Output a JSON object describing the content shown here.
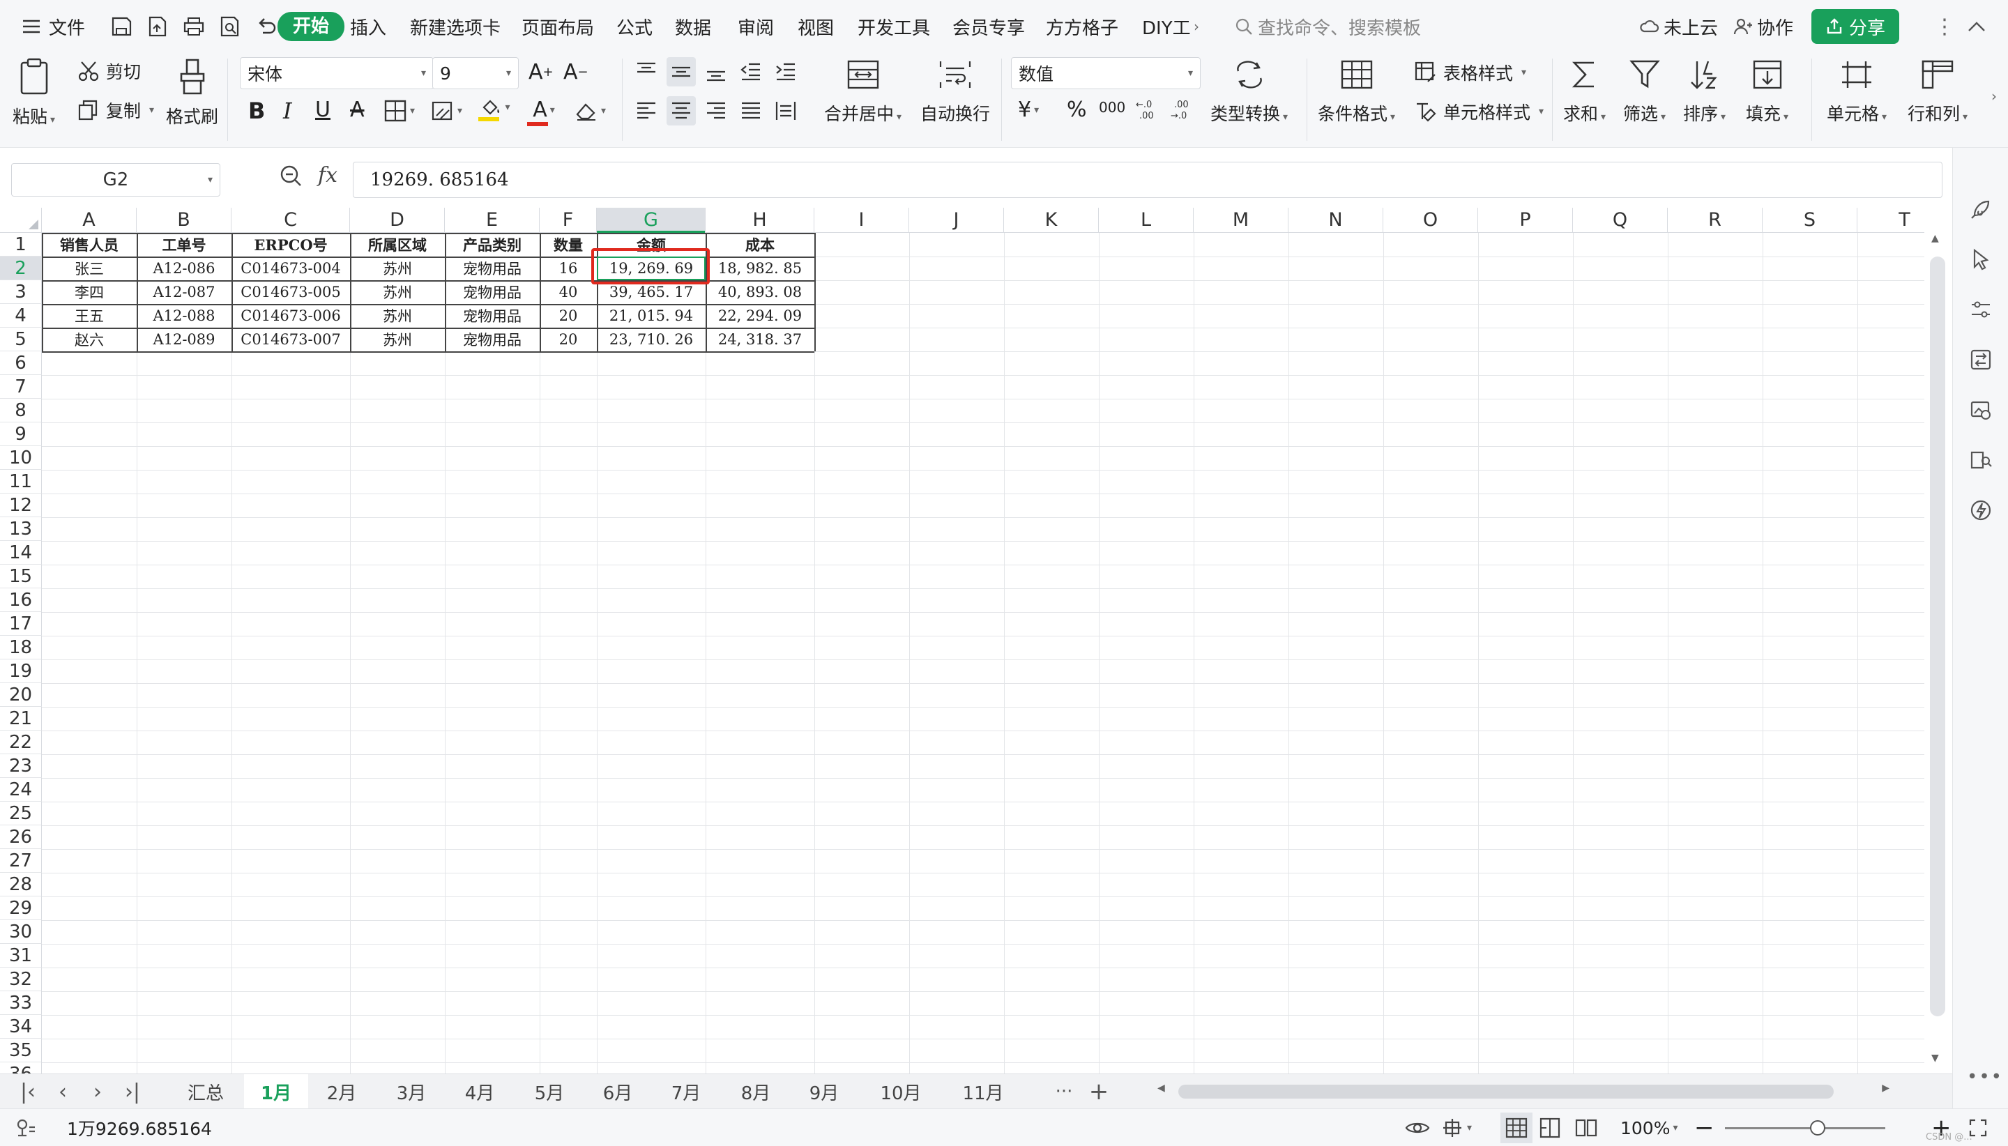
{
  "menubar": {
    "file_label": "文件",
    "tabs": [
      "开始",
      "插入",
      "新建选项卡",
      "页面布局",
      "公式",
      "数据",
      "审阅",
      "视图",
      "开发工具",
      "会员专享",
      "方方格子",
      "DIY工"
    ],
    "search_placeholder": "查找命令、搜索模板",
    "cloud_label": "未上云",
    "collab_label": "协作",
    "share_label": "分享"
  },
  "ribbon": {
    "paste": "粘贴",
    "cut": "剪切",
    "copy": "复制",
    "format_painter": "格式刷",
    "font_name": "宋体",
    "font_size": "9",
    "merge_center": "合并居中",
    "wrap_text": "自动换行",
    "number_format": "数值",
    "currency_symbol": "¥",
    "percent_symbol": "%",
    "thousands_symbol": "000",
    "type_convert": "类型转换",
    "cond_format": "条件格式",
    "table_style": "表格样式",
    "cell_style": "单元格样式",
    "sum": "求和",
    "filter": "筛选",
    "sort": "排序",
    "fill": "填充",
    "cell": "单元格",
    "row_col": "行和列",
    "accent_color": "#19a05b",
    "font_color_bar": "#e02a1f",
    "fill_color_bar": "#f5d800"
  },
  "formula_bar": {
    "name_box": "G2",
    "fx": "fx",
    "formula": "19269. 685164"
  },
  "grid": {
    "columns": [
      "A",
      "B",
      "C",
      "D",
      "E",
      "F",
      "G",
      "H",
      "I",
      "J",
      "K",
      "L",
      "M",
      "N",
      "O",
      "P",
      "Q",
      "R",
      "S",
      "T"
    ],
    "row_numbers": [
      "1",
      "2",
      "3",
      "4",
      "5",
      "6",
      "7",
      "8",
      "9",
      "10",
      "11",
      "12",
      "13",
      "14",
      "15",
      "16",
      "17",
      "18",
      "19",
      "20",
      "21",
      "22",
      "23",
      "24",
      "25",
      "26",
      "27",
      "28",
      "29",
      "30",
      "31",
      "32",
      "33",
      "34",
      "35",
      "36"
    ],
    "active_cell": "G2",
    "table": {
      "headers": [
        "销售人员",
        "工单号",
        "ERPCO号",
        "所属区域",
        "产品类别",
        "数量",
        "金额",
        "成本"
      ],
      "rows": [
        [
          "张三",
          "A12-086",
          "C014673-004",
          "苏州",
          "宠物用品",
          "16",
          "19, 269. 69",
          "18, 982. 85"
        ],
        [
          "李四",
          "A12-087",
          "C014673-005",
          "苏州",
          "宠物用品",
          "40",
          "39, 465. 17",
          "40, 893. 08"
        ],
        [
          "王五",
          "A12-088",
          "C014673-006",
          "苏州",
          "宠物用品",
          "20",
          "21, 015. 94",
          "22, 294. 09"
        ],
        [
          "赵六",
          "A12-089",
          "C014673-007",
          "苏州",
          "宠物用品",
          "20",
          "23, 710. 26",
          "24, 318. 37"
        ]
      ]
    },
    "highlight_color": "#e02a1f"
  },
  "sheet_tabs": {
    "tabs": [
      "汇总",
      "1月",
      "2月",
      "3月",
      "4月",
      "5月",
      "6月",
      "7月",
      "8月",
      "9月",
      "10月",
      "11月"
    ],
    "active": "1月",
    "more": "···",
    "add": "+"
  },
  "statusbar": {
    "value": "1万9269.685164",
    "zoom": "100%",
    "watermark": "CSDN @..."
  }
}
